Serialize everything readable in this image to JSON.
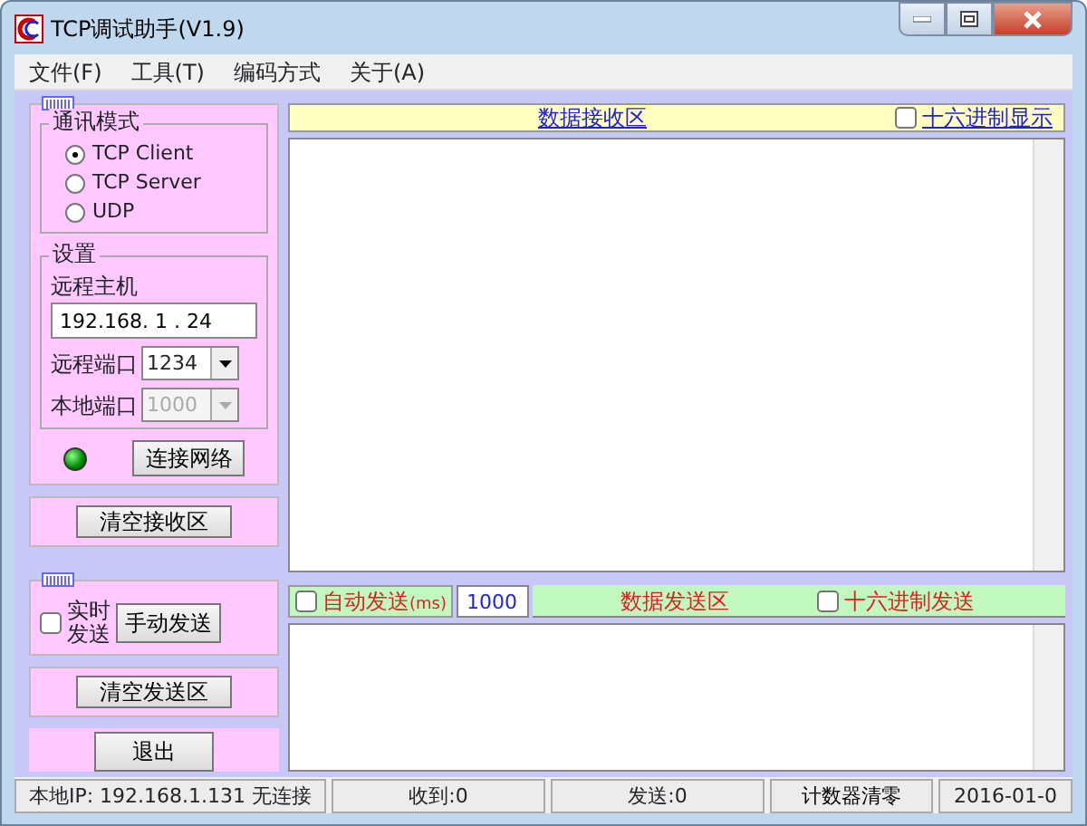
{
  "window": {
    "title": "TCP调试助手(V1.9)"
  },
  "menu": [
    "文件(F)",
    "工具(T)",
    "编码方式",
    "关于(A)"
  ],
  "mode_group": {
    "title": "通讯模式",
    "options": [
      {
        "label": "TCP Client",
        "selected": true
      },
      {
        "label": "TCP Server",
        "selected": false
      },
      {
        "label": "UDP",
        "selected": false
      }
    ]
  },
  "settings": {
    "title": "设置",
    "host_label": "远程主机",
    "host_value": "192.168. 1 . 24",
    "remote_port_label": "远程端口",
    "remote_port_value": "1234",
    "local_port_label": "本地端口",
    "local_port_value": "1000",
    "local_port_disabled": true,
    "connect_button": "连接网络"
  },
  "clear_receive_button": "清空接收区",
  "send_group": {
    "realtime_label": "实时发送",
    "realtime_checked": false,
    "manual_send_button": "手动发送"
  },
  "clear_send_button": "清空发送区",
  "exit_button": "退出",
  "receive": {
    "title": "数据接收区",
    "hex_label": "十六进制显示",
    "hex_checked": false
  },
  "send": {
    "auto_label": "自动发送",
    "auto_unit": "(ms)",
    "auto_checked": false,
    "interval": "1000",
    "title": "数据发送区",
    "hex_label": "十六进制发送",
    "hex_checked": false
  },
  "status_bar": {
    "local_ip": "本地IP: 192.168.1.131 无连接",
    "received": "收到:0",
    "sent": "发送:0",
    "reset_button": "计数器清零",
    "date": "2016-01-0"
  }
}
